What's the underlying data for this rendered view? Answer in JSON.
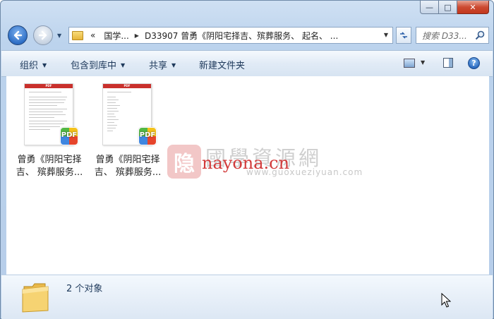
{
  "window": {
    "caption": {
      "minimize": "—",
      "maximize": "□",
      "close": "✕"
    }
  },
  "nav": {
    "address_prefix": "«",
    "breadcrumbs": [
      "国学...",
      "D33907 曾勇《阴阳宅择吉、殡葬服务、 起名、 ..."
    ],
    "search_placeholder": "搜索 D33..."
  },
  "toolbar": {
    "organize": "组织",
    "include_library": "包含到库中",
    "share": "共享",
    "new_folder": "新建文件夹"
  },
  "files": [
    {
      "name_line1": "曾勇《阴阳宅择",
      "name_line2": "吉、 殡葬服务...",
      "badge": "PDF",
      "thumb_header": "PDF"
    },
    {
      "name_line1": "曾勇《阴阳宅择",
      "name_line2": "吉、 殡葬服务...",
      "badge": "PDF",
      "thumb_header": "PDF"
    }
  ],
  "watermark": {
    "logo_char": "隐",
    "cn": "國學資源網",
    "domain": "nayona.cn",
    "url": "www.guoxueziyuan.com"
  },
  "status": {
    "object_count": "2 个对象"
  },
  "colors": {
    "accent": "#1e395b",
    "close": "#c2371c",
    "pdf_red": "#c9302c"
  }
}
